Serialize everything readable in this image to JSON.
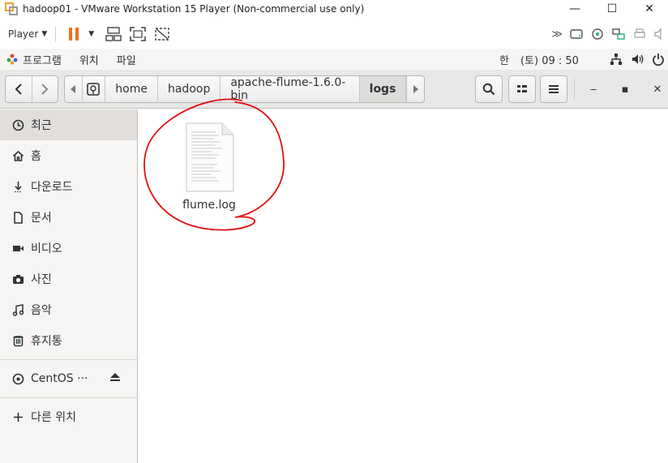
{
  "vm": {
    "title": "hadoop01 - VMware Workstation 15 Player (Non-commercial use only)",
    "player_label": "Player",
    "window_controls": {
      "minimize": "—",
      "maximize": "☐",
      "close": "✕"
    }
  },
  "gnome": {
    "menus": [
      {
        "label": "프로그램",
        "icon": "apps-icon"
      },
      {
        "label": "위치"
      },
      {
        "label": "파일"
      }
    ],
    "clock_prefix": "한",
    "clock": "(토) 09 : 50"
  },
  "nautilus": {
    "path": [
      "home",
      "hadoop",
      "apache-flume-1.6.0-bin",
      "logs"
    ],
    "active_index": 3,
    "window_controls": {
      "minimize": "‒",
      "maximize": "▪",
      "close": "✕"
    }
  },
  "sidebar": {
    "items": [
      {
        "label": "최근",
        "icon": "clock-icon"
      },
      {
        "label": "홈",
        "icon": "home-icon"
      },
      {
        "label": "다운로드",
        "icon": "download-icon"
      },
      {
        "label": "문서",
        "icon": "document-icon"
      },
      {
        "label": "비디오",
        "icon": "video-icon"
      },
      {
        "label": "사진",
        "icon": "camera-icon"
      },
      {
        "label": "음악",
        "icon": "music-icon"
      },
      {
        "label": "휴지통",
        "icon": "trash-icon"
      }
    ],
    "device": {
      "label": "CentOS ···",
      "icon": "disc-icon"
    },
    "other": {
      "label": "다른 위치",
      "icon": "plus-icon"
    }
  },
  "files": [
    {
      "name": "flume.log",
      "icon": "text-file-icon"
    }
  ],
  "colors": {
    "annotation": "#e01010",
    "pause": "#f07020",
    "selected": "#e1dedb"
  }
}
